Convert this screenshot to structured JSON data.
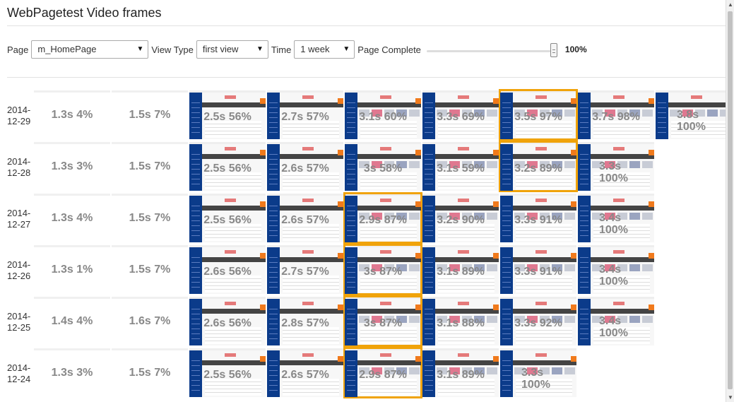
{
  "title": "WebPagetest Video frames",
  "controls": {
    "page_label": "Page",
    "page_value": "m_HomePage",
    "view_label": "View Type",
    "view_value": "first view",
    "time_label": "Time",
    "time_value": "1 week",
    "complete_label": "Page Complete",
    "complete_value": "100%",
    "complete_fraction": 1.0
  },
  "rows": [
    {
      "date": [
        "2014-",
        "12-29"
      ],
      "frames": [
        {
          "label": "1.3s 4%",
          "kind": "blank"
        },
        {
          "label": "1.5s 7%",
          "kind": "blank"
        },
        {
          "label": "2.5s 56%",
          "kind": "partial"
        },
        {
          "label": "2.7s 57%",
          "kind": "partial"
        },
        {
          "label": "3.1s 60%",
          "kind": "full"
        },
        {
          "label": "3.3s 69%",
          "kind": "full"
        },
        {
          "label": "3.5s 97%",
          "kind": "full",
          "highlight": true
        },
        {
          "label": "3.7s 98%",
          "kind": "full"
        },
        {
          "label": "3.8s|100%",
          "kind": "full"
        }
      ]
    },
    {
      "date": [
        "2014-",
        "12-28"
      ],
      "frames": [
        {
          "label": "1.3s 3%",
          "kind": "blank"
        },
        {
          "label": "1.5s 7%",
          "kind": "blank"
        },
        {
          "label": "2.5s 56%",
          "kind": "partial"
        },
        {
          "label": "2.6s 57%",
          "kind": "partial"
        },
        {
          "label": "3s 58%",
          "kind": "full"
        },
        {
          "label": "3.1s 59%",
          "kind": "full"
        },
        {
          "label": "3.2s 89%",
          "kind": "full",
          "highlight": true
        },
        {
          "label": "3.3s|100%",
          "kind": "full"
        }
      ]
    },
    {
      "date": [
        "2014-",
        "12-27"
      ],
      "frames": [
        {
          "label": "1.3s 4%",
          "kind": "blank"
        },
        {
          "label": "1.5s 7%",
          "kind": "blank"
        },
        {
          "label": "2.5s 56%",
          "kind": "partial"
        },
        {
          "label": "2.6s 57%",
          "kind": "partial"
        },
        {
          "label": "2.9s 87%",
          "kind": "full",
          "highlight": true
        },
        {
          "label": "3.2s 90%",
          "kind": "full"
        },
        {
          "label": "3.3s 91%",
          "kind": "full"
        },
        {
          "label": "3.4s|100%",
          "kind": "full"
        }
      ]
    },
    {
      "date": [
        "2014-",
        "12-26"
      ],
      "frames": [
        {
          "label": "1.3s 1%",
          "kind": "blank"
        },
        {
          "label": "1.5s 7%",
          "kind": "blank"
        },
        {
          "label": "2.6s 56%",
          "kind": "partial"
        },
        {
          "label": "2.7s 57%",
          "kind": "partial"
        },
        {
          "label": "3s 87%",
          "kind": "full",
          "highlight": true
        },
        {
          "label": "3.1s 89%",
          "kind": "full"
        },
        {
          "label": "3.3s 91%",
          "kind": "full"
        },
        {
          "label": "3.4s|100%",
          "kind": "full"
        }
      ]
    },
    {
      "date": [
        "2014-",
        "12-25"
      ],
      "frames": [
        {
          "label": "1.4s 4%",
          "kind": "blank"
        },
        {
          "label": "1.6s 7%",
          "kind": "blank"
        },
        {
          "label": "2.6s 56%",
          "kind": "partial"
        },
        {
          "label": "2.8s 57%",
          "kind": "partial"
        },
        {
          "label": "3s 87%",
          "kind": "full",
          "highlight": true
        },
        {
          "label": "3.1s 88%",
          "kind": "full"
        },
        {
          "label": "3.3s 92%",
          "kind": "full"
        },
        {
          "label": "3.4s|100%",
          "kind": "full"
        }
      ]
    },
    {
      "date": [
        "2014-",
        "12-24"
      ],
      "frames": [
        {
          "label": "1.3s 3%",
          "kind": "blank"
        },
        {
          "label": "1.5s 7%",
          "kind": "blank"
        },
        {
          "label": "2.5s 56%",
          "kind": "partial"
        },
        {
          "label": "2.6s 57%",
          "kind": "partial"
        },
        {
          "label": "2.9s 87%",
          "kind": "full",
          "highlight": true
        },
        {
          "label": "3.1s 89%",
          "kind": "full"
        },
        {
          "label": "3.3s|100%",
          "kind": "full"
        }
      ]
    }
  ],
  "colors": {
    "highlight": "#f0a30a",
    "sidebar": "#0b3b8a",
    "accent": "#f07a1c"
  }
}
